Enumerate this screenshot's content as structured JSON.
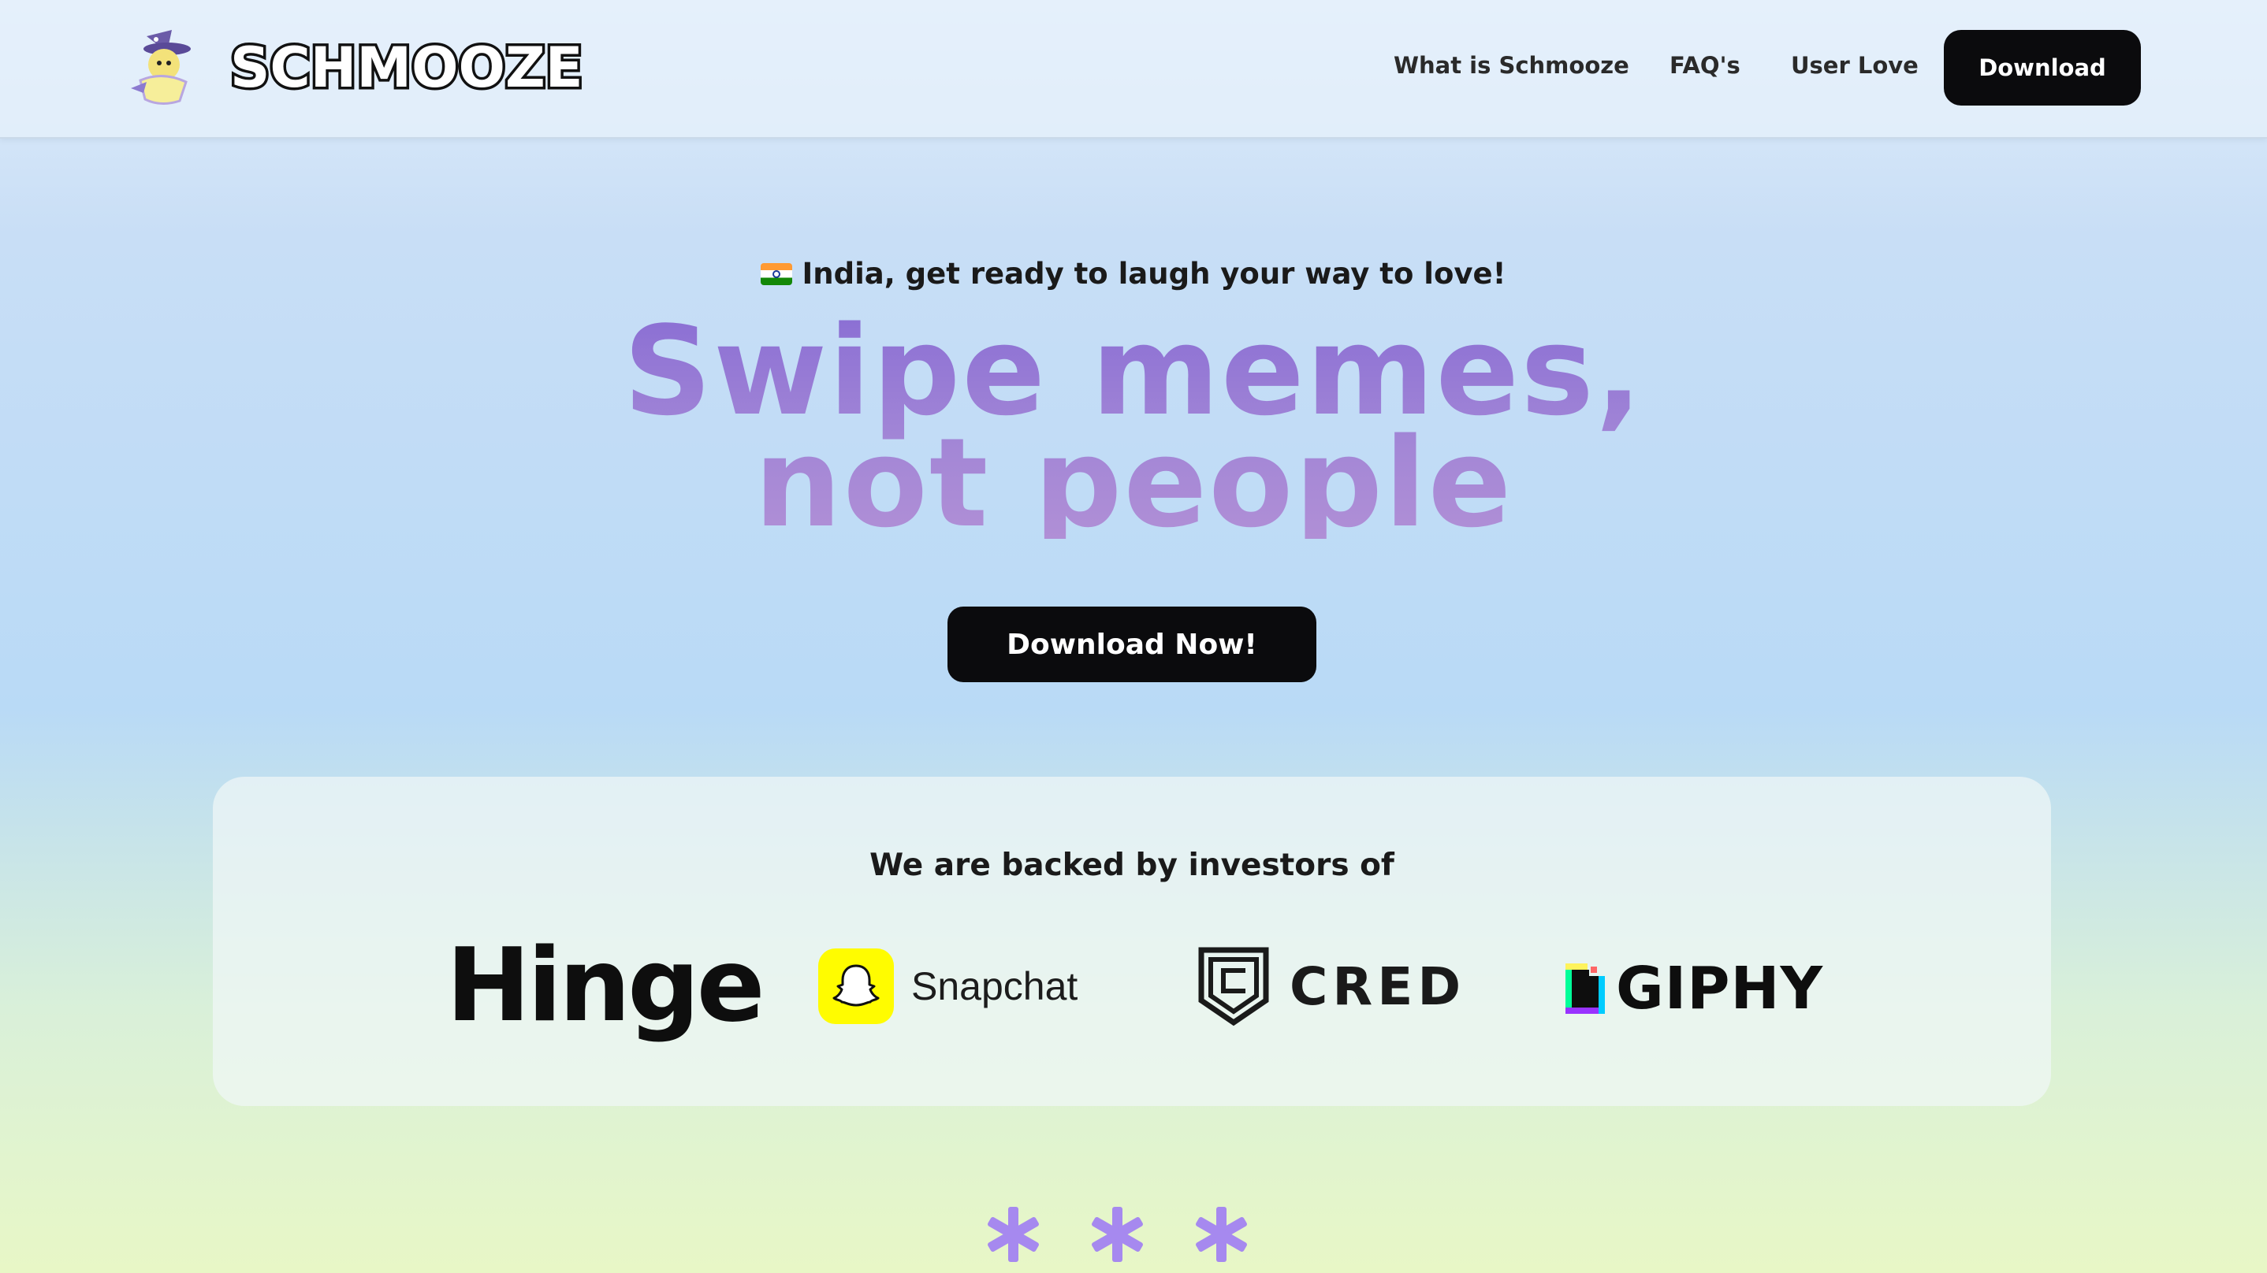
{
  "header": {
    "logo_text": "SCHMOOZE",
    "mascot_icon": "mascot-wizard-icon",
    "nav": {
      "what_is": "What is Schmooze",
      "faqs": "FAQ's",
      "user_love": "User Love",
      "download": "Download"
    }
  },
  "hero": {
    "tagline": "India, get ready to laugh your way to love!",
    "flag_icon": "india-flag-icon",
    "headline_line1": "Swipe memes,",
    "headline_line2": "not people",
    "cta_label": "Download Now!"
  },
  "investors": {
    "title": "We are backed by investors of",
    "logos": [
      {
        "name": "Hinge",
        "text": "Hinge"
      },
      {
        "name": "Snapchat",
        "text": "Snapchat",
        "icon": "snapchat-ghost-icon",
        "color": "#fffc00"
      },
      {
        "name": "CRED",
        "text": "CRED",
        "icon": "cred-shield-icon"
      },
      {
        "name": "GIPHY",
        "text": "GIPHY",
        "icon": "giphy-icon"
      }
    ]
  },
  "colors": {
    "headline": "#9c80d6",
    "button": "#0b0b0d",
    "asterisk": "#a689ef"
  }
}
